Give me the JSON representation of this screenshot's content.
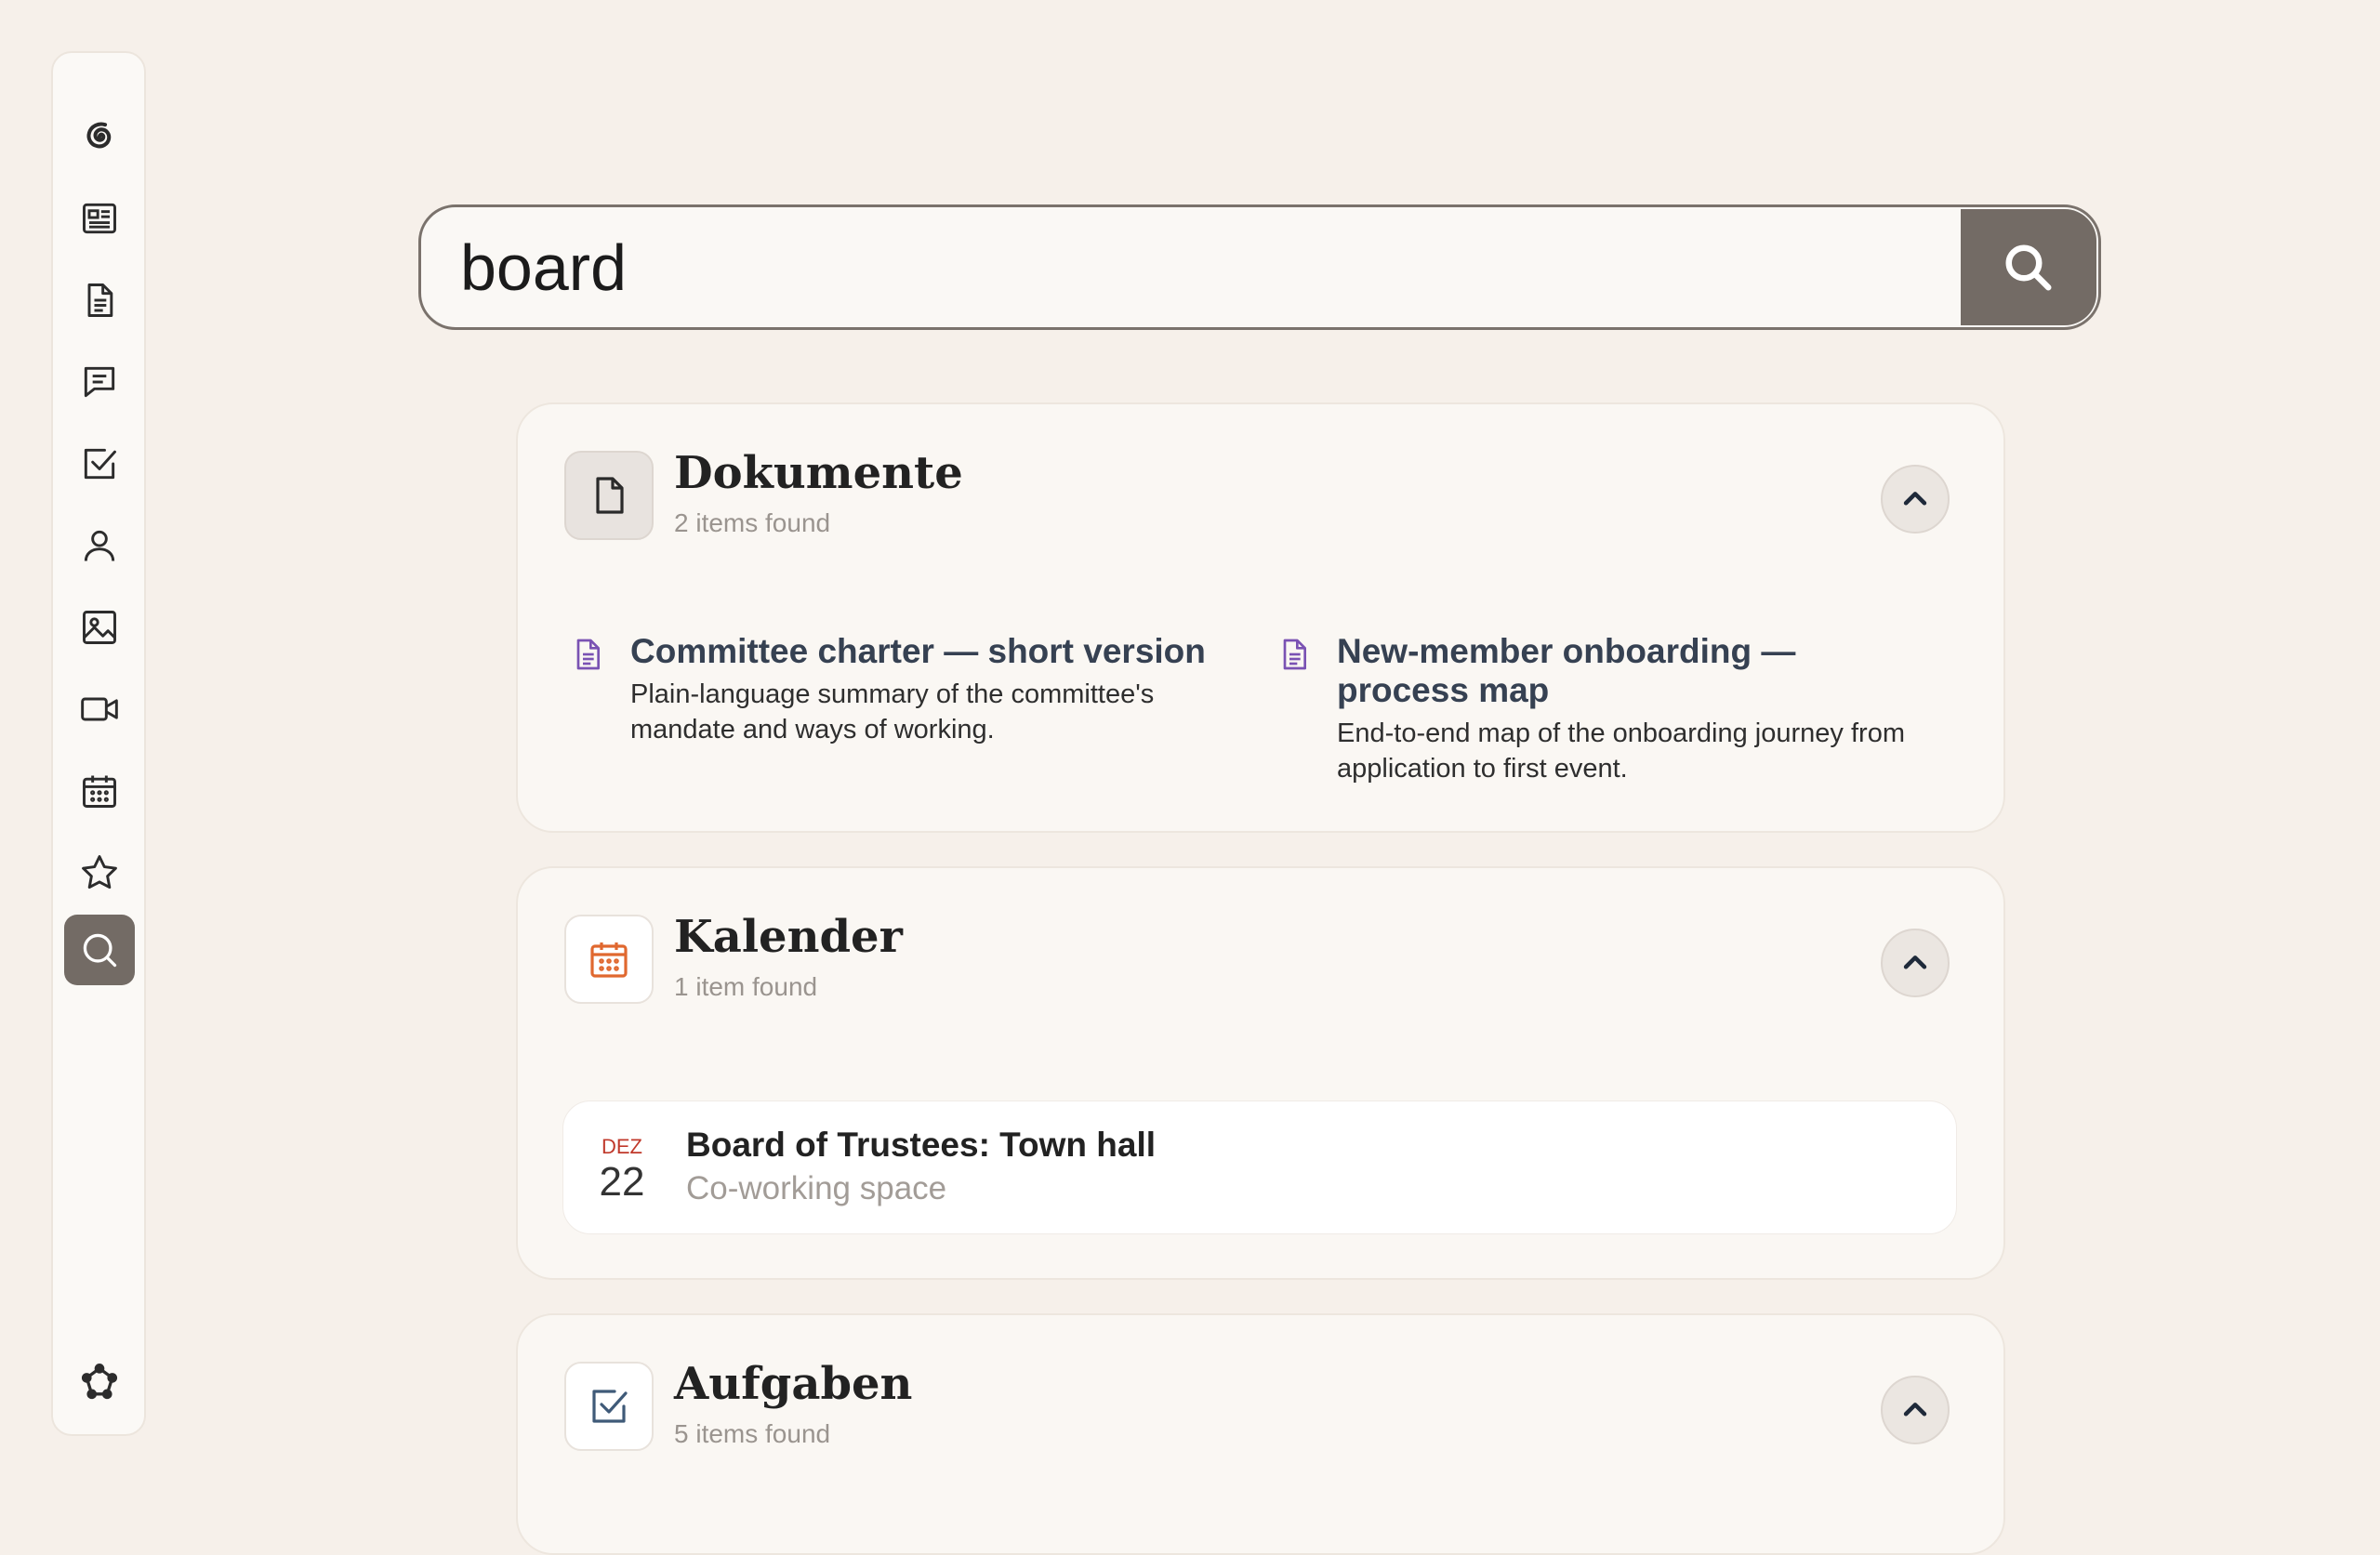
{
  "search": {
    "value": "board",
    "placeholder": ""
  },
  "sidebar": {
    "items": [
      {
        "icon": "spiral-logo-icon"
      },
      {
        "icon": "newspaper-icon"
      },
      {
        "icon": "document-icon"
      },
      {
        "icon": "chat-icon"
      },
      {
        "icon": "checkbox-icon"
      },
      {
        "icon": "user-icon"
      },
      {
        "icon": "image-icon"
      },
      {
        "icon": "video-icon"
      },
      {
        "icon": "calendar-icon"
      },
      {
        "icon": "star-icon"
      },
      {
        "icon": "search-icon",
        "active": true
      },
      {
        "icon": "network-icon"
      }
    ]
  },
  "sections": {
    "documents": {
      "title": "Dokumente",
      "count": "2 items found",
      "results": [
        {
          "title": "Committee charter — short version",
          "description": "Plain-language summary of the committee's mandate and ways of working."
        },
        {
          "title": "New-member onboarding — process map",
          "description": "End-to-end map of the onboarding journey from application to first event."
        }
      ]
    },
    "calendar": {
      "title": "Kalender",
      "count": "1 item found",
      "events": [
        {
          "month": "DEZ",
          "day": "22",
          "title": "Board of Trustees: Town hall",
          "location": "Co-working space"
        }
      ]
    },
    "tasks": {
      "title": "Aufgaben",
      "count": "5 items found"
    }
  },
  "colors": {
    "background": "#f6f0ea",
    "accent": "#736b65",
    "doc_icon": "#7a52b3",
    "calendar_icon": "#e0682f",
    "task_icon": "#3f5a78",
    "event_month": "#c0392b"
  }
}
